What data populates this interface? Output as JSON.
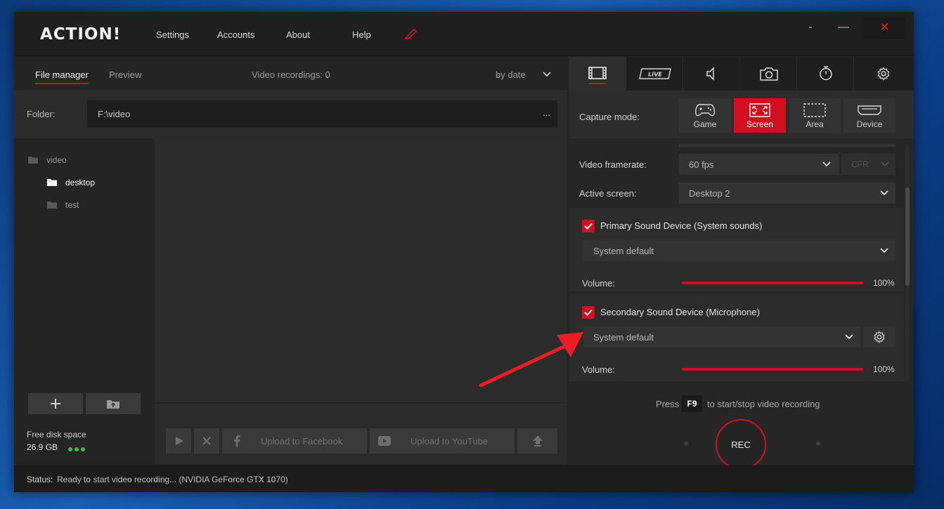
{
  "app": {
    "logo": "ACTION!",
    "menu": [
      "Settings",
      "Accounts",
      "About",
      "Help"
    ],
    "window_controls": {
      "minimize": "-",
      "maximize": "—",
      "close": "✕"
    }
  },
  "file_manager": {
    "tabs": [
      "File manager",
      "Preview"
    ],
    "recordings_count": "Video recordings: 0",
    "sort": "by date",
    "folder_label": "Folder:",
    "folder_path": "F:\\video",
    "folder_more": "...",
    "tree": [
      {
        "name": "video",
        "level": 0,
        "selected": false
      },
      {
        "name": "desktop",
        "level": 1,
        "selected": true
      },
      {
        "name": "test",
        "level": 1,
        "selected": false
      }
    ],
    "free_disk_label": "Free disk space",
    "free_disk_value": "26.9 GB",
    "upload_facebook": "Upload to Facebook",
    "upload_youtube": "Upload to YouTube"
  },
  "right_panel": {
    "tab_icons": [
      "video-icon",
      "live-icon",
      "audio-icon",
      "camera-icon",
      "timer-icon",
      "gear-icon"
    ],
    "live_tab_label": "LIVE",
    "capture_mode_label": "Capture mode:",
    "capture_modes": [
      "Game",
      "Screen",
      "Area",
      "Device"
    ],
    "active_capture_mode": "Screen",
    "framerate_label": "Video framerate:",
    "framerate_value": "60 fps",
    "framerate_mode": "CFR",
    "active_screen_label": "Active screen:",
    "active_screen_value": "Desktop 2",
    "primary_sound": {
      "title": "Primary Sound Device (System sounds)",
      "checked": true,
      "device": "System default",
      "volume_label": "Volume:",
      "volume": "100%"
    },
    "secondary_sound": {
      "title": "Secondary Sound Device (Microphone)",
      "checked": true,
      "device": "System default",
      "volume_label": "Volume:",
      "volume": "100%"
    },
    "hint_press": "Press",
    "hint_key": "F9",
    "hint_text": "to start/stop video recording",
    "rec_label": "REC"
  },
  "status": {
    "label": "Status:",
    "text": "Ready to start video recording... (NVIDIA GeForce GTX 1070)"
  },
  "colors": {
    "accent": "#d0101f",
    "disk_ok": "#2fbf4a",
    "background": "#262626"
  }
}
